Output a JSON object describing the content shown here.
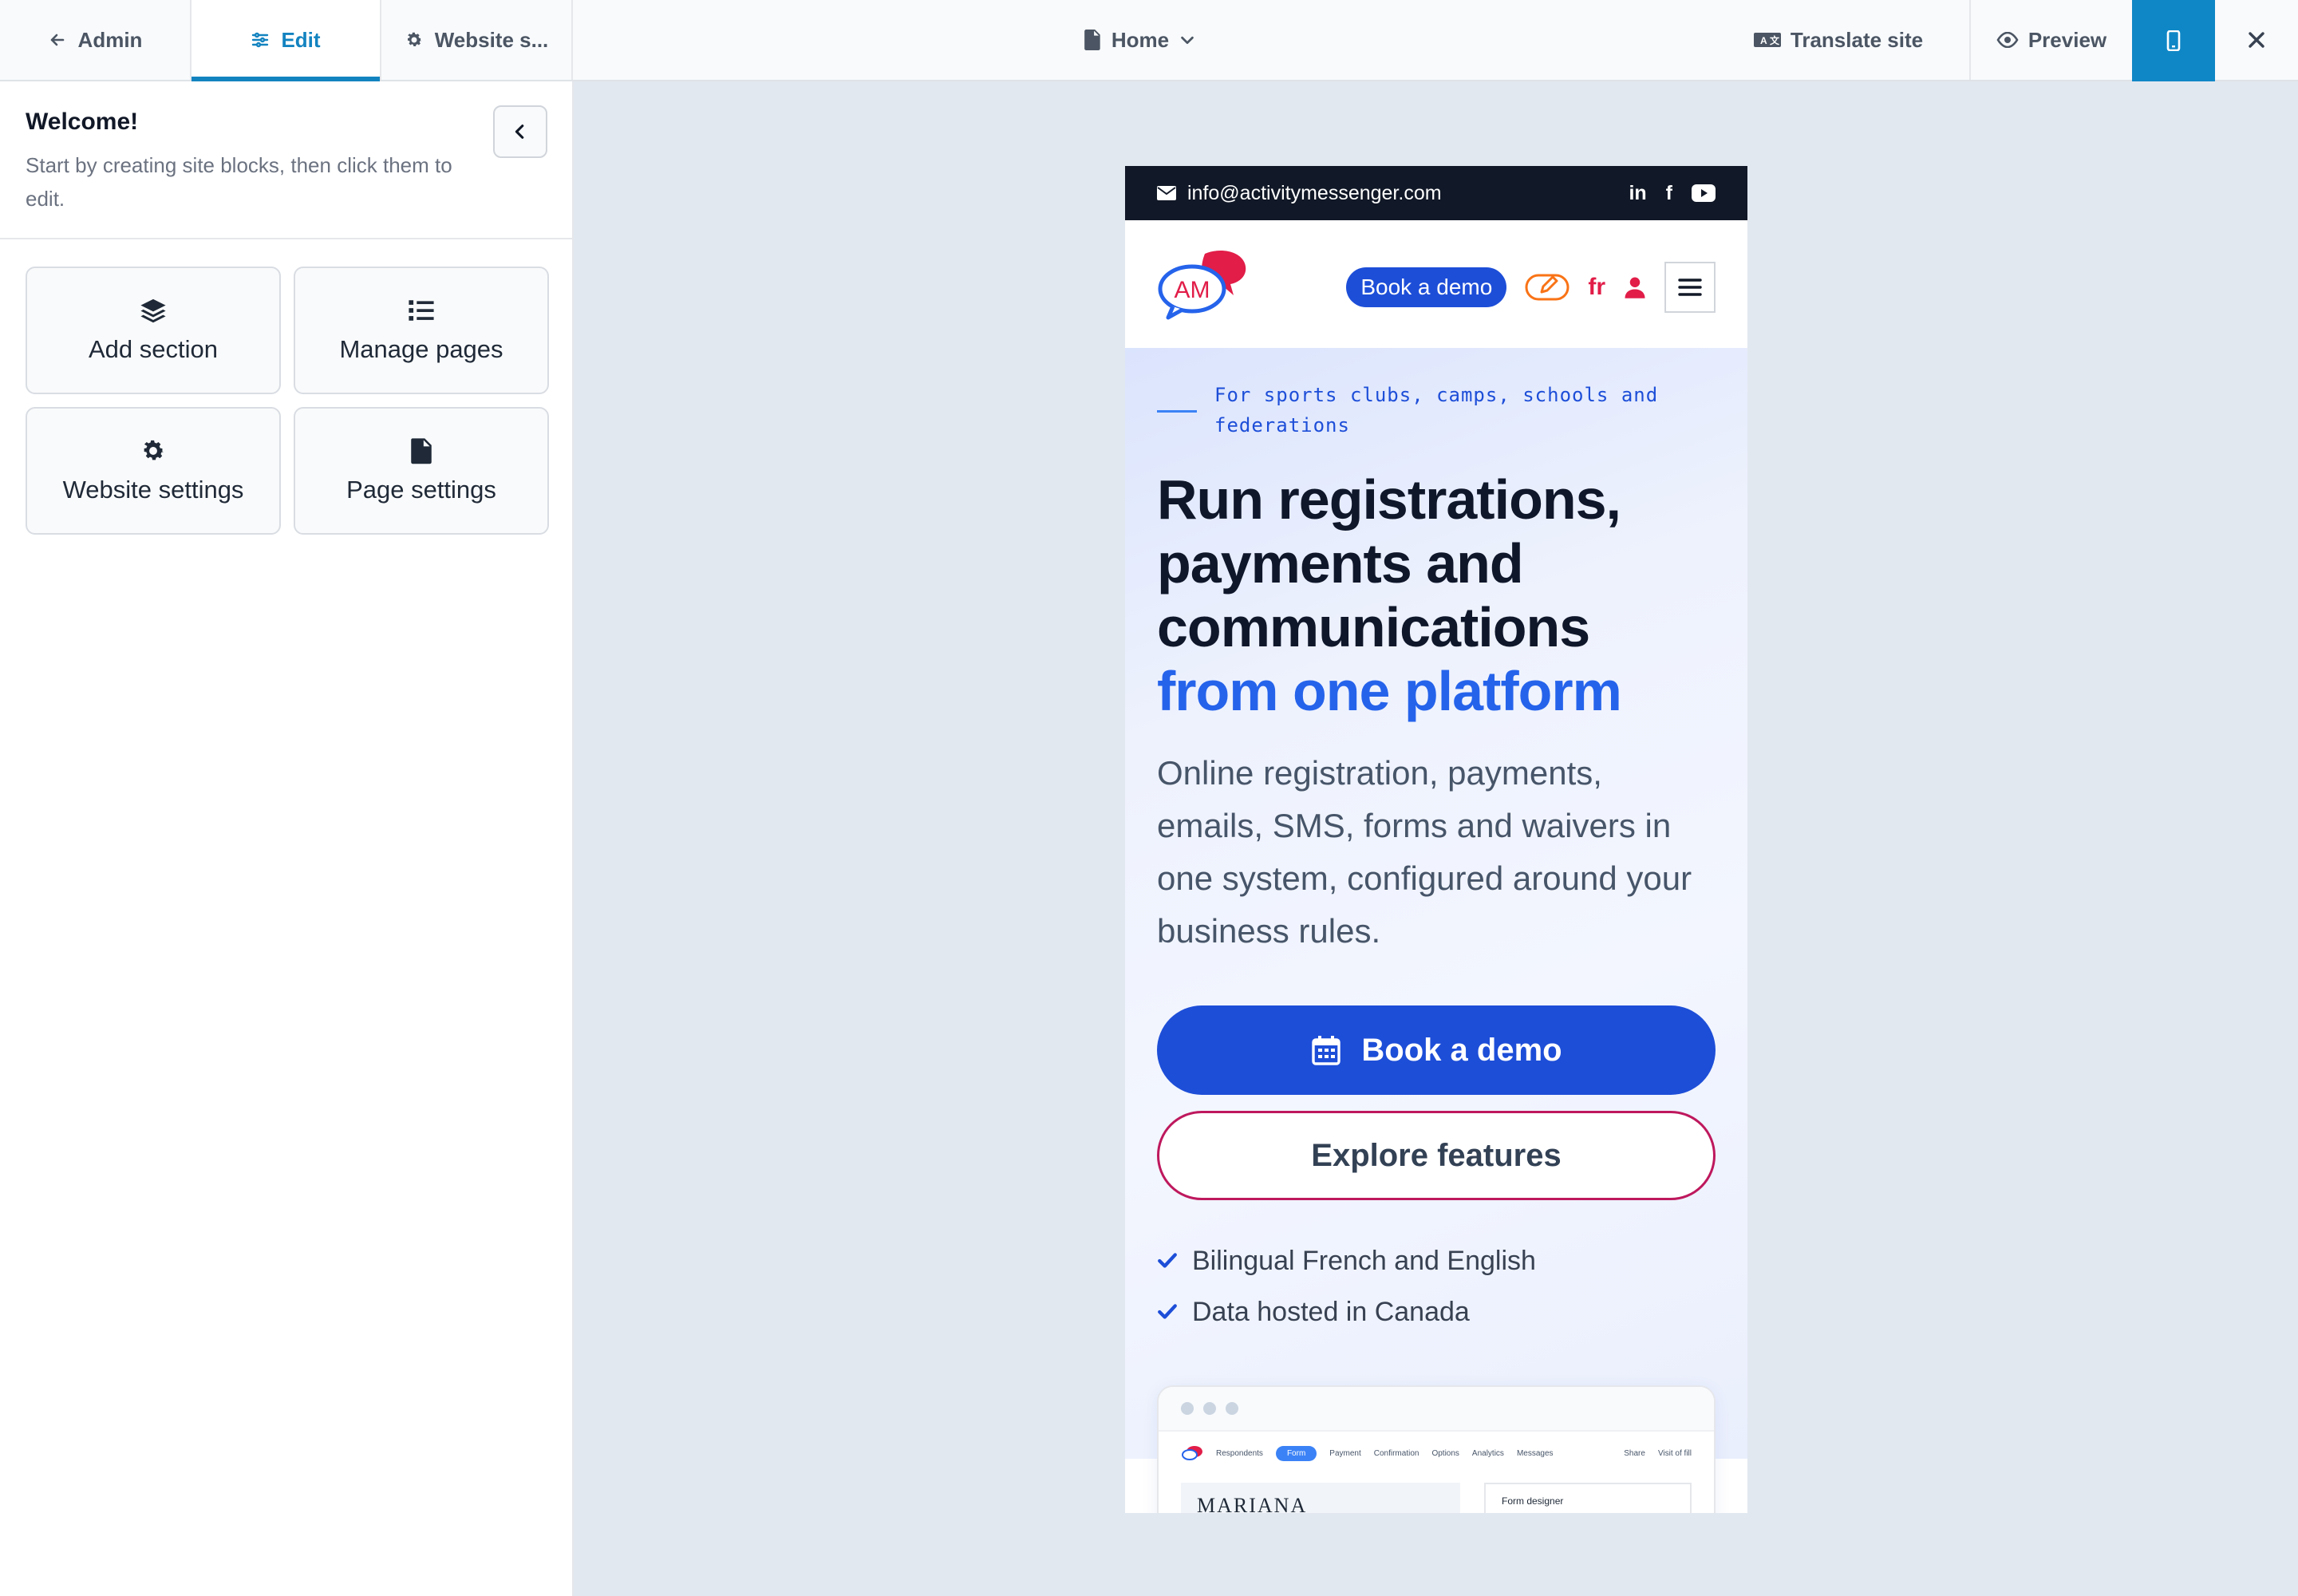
{
  "topbar": {
    "admin_label": "Admin",
    "edit_label": "Edit",
    "website_settings_label": "Website s...",
    "page_label": "Home",
    "translate_label": "Translate site",
    "preview_label": "Preview"
  },
  "sidebar": {
    "welcome_title": "Welcome!",
    "welcome_text": "Start by creating site blocks, then click them to edit.",
    "cards": [
      {
        "label": "Add section",
        "icon": "layers-icon"
      },
      {
        "label": "Manage pages",
        "icon": "list-icon"
      },
      {
        "label": "Website settings",
        "icon": "gear-icon"
      },
      {
        "label": "Page settings",
        "icon": "file-icon"
      }
    ]
  },
  "preview": {
    "email": "info@activitymessenger.com",
    "social": [
      "in",
      "f",
      "youtube"
    ],
    "logo_text": "AM",
    "nav_demo_label": "Book a demo",
    "lang_label": "fr",
    "eyebrow": "For sports clubs, camps, schools and federations",
    "headline": "Run registrations, payments and communications",
    "headline_accent": "from one platform",
    "subtitle": "Online registration, payments, emails, SMS, forms and waivers in one system, configured around your business rules.",
    "primary_cta": "Book a demo",
    "secondary_cta": "Explore features",
    "checks": [
      "Bilingual French and English",
      "Data hosted in Canada"
    ],
    "screenshot": {
      "nav": [
        "Respondents",
        "Form",
        "Payment",
        "Confirmation",
        "Options",
        "Analytics",
        "Messages"
      ],
      "nav_right": [
        "Share",
        "Visit of fill"
      ],
      "image_text": "MARIANA",
      "panel_title": "Form designer"
    }
  },
  "colors": {
    "accent": "#1383c0",
    "brand_blue": "#1d4ed8",
    "brand_pink": "#e11d48",
    "dark": "#111827"
  }
}
